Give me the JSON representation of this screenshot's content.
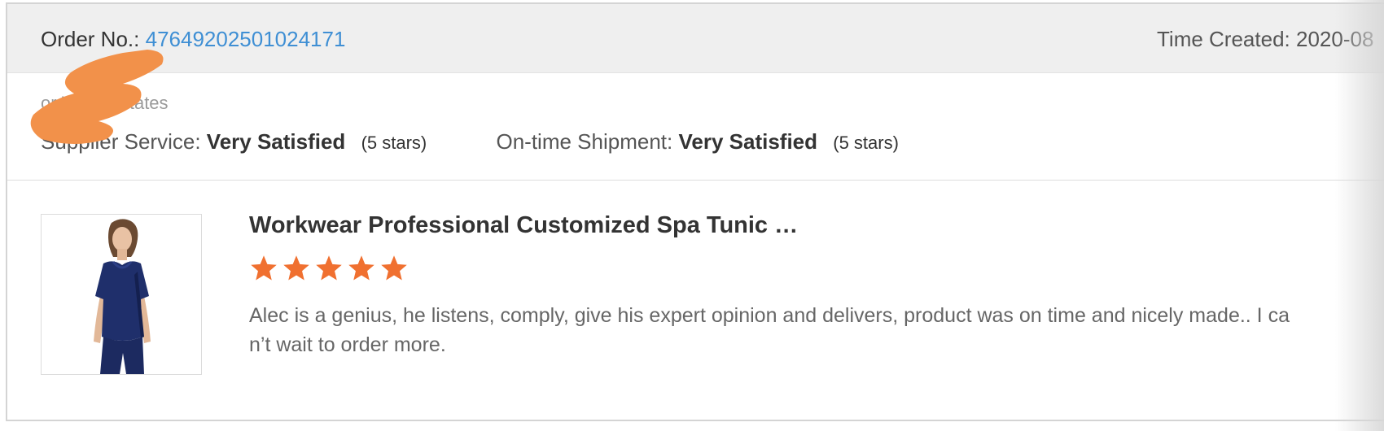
{
  "order": {
    "label": "Order No.:",
    "number": "47649202501024171",
    "time_created_label": "Time Created:",
    "time_created_value": "2020-08"
  },
  "buyer": {
    "location": "or,United States"
  },
  "ratings": {
    "supplier_service_label": "Supplier Service:",
    "supplier_service_value": "Very Satisfied",
    "supplier_service_stars": "(5 stars)",
    "shipment_label": "On-time Shipment:",
    "shipment_value": "Very Satisfied",
    "shipment_stars": "(5 stars)"
  },
  "product": {
    "title": "Workwear Professional Customized Spa Tunic …",
    "rating": 5,
    "rating_max": 5,
    "review": "Alec is a genius, he listens, comply, give his expert opinion and delivers, product was on time and nicely made.. I can’t wait to order more."
  },
  "colors": {
    "link": "#3f8fd4",
    "star": "#f07030",
    "redaction": "#f2914a",
    "header_bg": "#efefef",
    "tunic": "#1f2f6b"
  },
  "icons": {
    "star": "star-icon"
  }
}
